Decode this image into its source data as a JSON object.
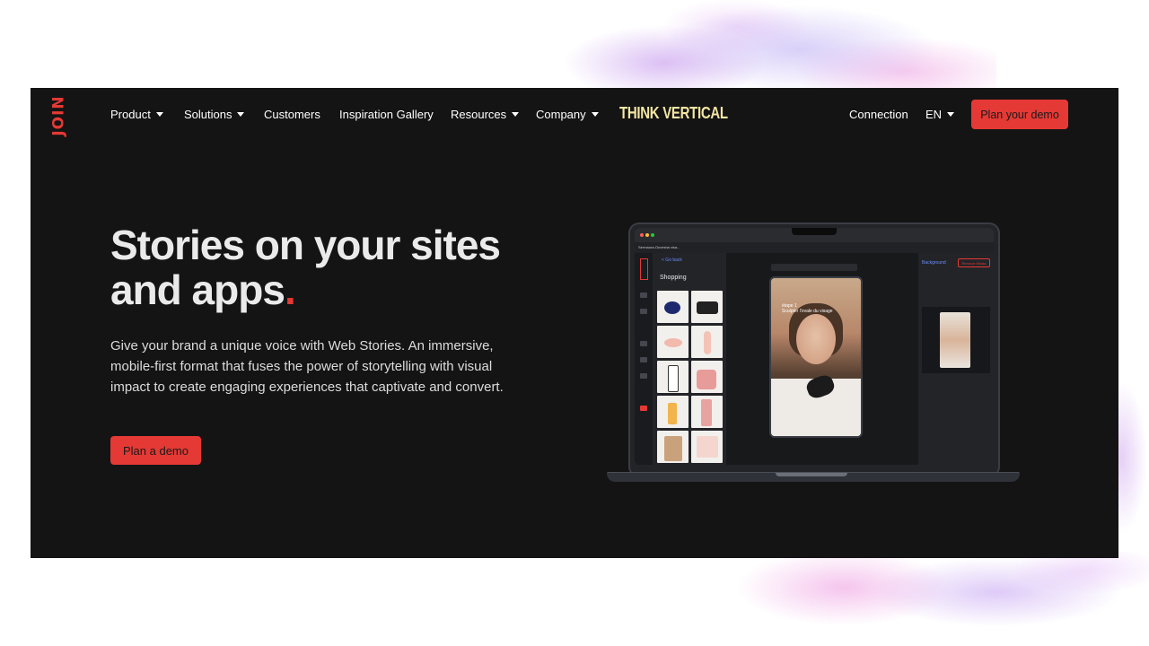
{
  "colors": {
    "accent": "#e53935",
    "background": "#141414",
    "think_vertical": "#f3e6a3"
  },
  "nav": {
    "logo": "JOIN",
    "items": [
      {
        "label": "Product",
        "dropdown": true
      },
      {
        "label": "Solutions",
        "dropdown": true
      },
      {
        "label": "Customers",
        "dropdown": false
      },
      {
        "label": "Inspiration Gallery",
        "dropdown": false
      },
      {
        "label": "Resources",
        "dropdown": true
      },
      {
        "label": "Company",
        "dropdown": true
      }
    ],
    "think_vertical": "THINK VERTICAL",
    "connection": "Connection",
    "language": "EN",
    "cta": "Plan your demo"
  },
  "hero": {
    "title_line1": "Stories on your sites",
    "title_line2": "and apps",
    "title_dot": ".",
    "description": "Give your brand a unique voice with Web Stories. An immersive, mobile-first format that fuses the power of storytelling with visual impact to create engaging experiences that captivate and convert.",
    "cta": "Plan a demo"
  },
  "editor_mock": {
    "tab_title": "Sermaora-Ouvesha visa...",
    "back": "< Go back",
    "panel_title": "Shopping",
    "caption": "étape 1\nSculpter l'ovale du visage",
    "properties": {
      "background_label": "Background",
      "remove_media": "Remove Media"
    }
  }
}
